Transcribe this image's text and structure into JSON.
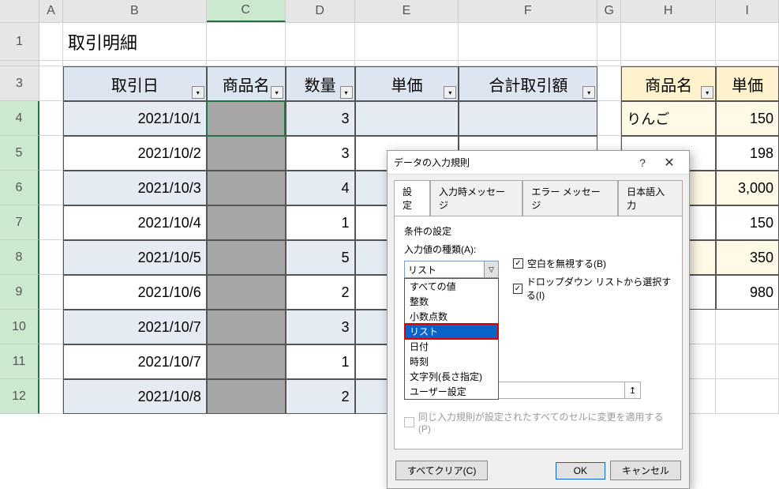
{
  "columns": [
    "A",
    "B",
    "C",
    "D",
    "E",
    "F",
    "G",
    "H",
    "I"
  ],
  "rows": [
    "1",
    "",
    "3",
    "4",
    "5",
    "6",
    "7",
    "8",
    "9",
    "10",
    "11",
    "12"
  ],
  "title_cell": "取引明細",
  "headers_main": {
    "b": "取引日",
    "c": "商品名",
    "d": "数量",
    "e": "単価",
    "f": "合計取引額"
  },
  "headers_side": {
    "h": "商品名",
    "i": "単価"
  },
  "data_rows": [
    {
      "b": "2021/10/1",
      "d": "3",
      "h": "りんご",
      "i": "150"
    },
    {
      "b": "2021/10/2",
      "d": "3",
      "h": "",
      "i": "198"
    },
    {
      "b": "2021/10/3",
      "d": "4",
      "h": "",
      "i": "3,000"
    },
    {
      "b": "2021/10/4",
      "d": "1",
      "h": "",
      "i": "150"
    },
    {
      "b": "2021/10/5",
      "d": "5",
      "h": "",
      "i": "350"
    },
    {
      "b": "2021/10/6",
      "d": "2",
      "h": "",
      "i": "980"
    },
    {
      "b": "2021/10/7",
      "d": "3"
    },
    {
      "b": "2021/10/7",
      "d": "1"
    },
    {
      "b": "2021/10/8",
      "d": "2"
    }
  ],
  "dialog": {
    "title": "データの入力規則",
    "tabs": [
      "設定",
      "入力時メッセージ",
      "エラー メッセージ",
      "日本語入力"
    ],
    "section_label": "条件の設定",
    "allow_label": "入力値の種類(A):",
    "allow_value": "リスト",
    "allow_options": [
      "すべての値",
      "整数",
      "小数点数",
      "リスト",
      "日付",
      "時刻",
      "文字列(長さ指定)",
      "ユーザー設定"
    ],
    "ignore_blank": "空白を無視する(B)",
    "in_cell_dropdown": "ドロップダウン リストから選択する(I)",
    "apply_all": "同じ入力規則が設定されたすべてのセルに変更を適用する(P)",
    "clear_all": "すべてクリア(C)",
    "ok": "OK",
    "cancel": "キャンセル"
  }
}
